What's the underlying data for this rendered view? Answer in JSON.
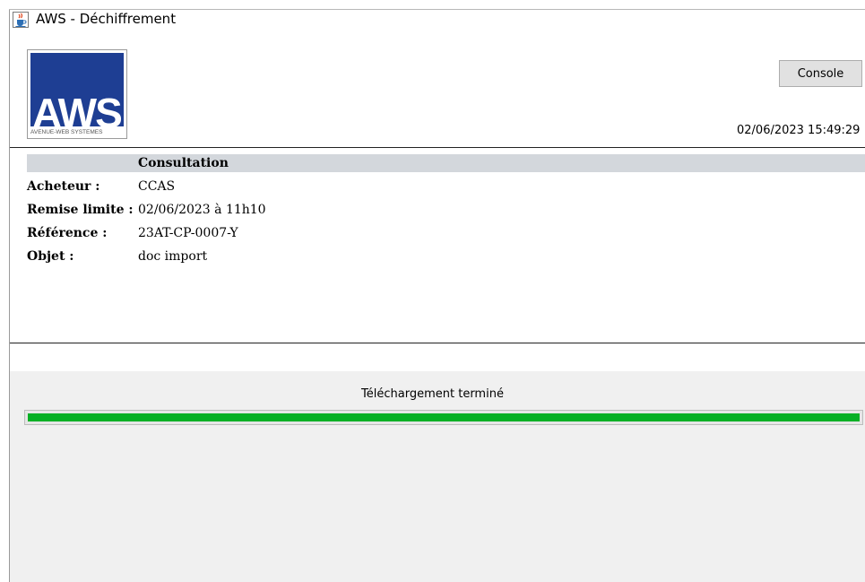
{
  "window": {
    "title": "AWS - Déchiffrement",
    "icon": "java-cup-icon"
  },
  "header": {
    "logo": {
      "text": "AWS",
      "subtitle": "AVENUE-WEB SYSTEMES",
      "color": "#1e3e93"
    },
    "console_label": "Console",
    "datetime": "02/06/2023 15:49:29"
  },
  "consultation": {
    "title": "Consultation",
    "fields": [
      {
        "label": "Acheteur :",
        "value": "CCAS"
      },
      {
        "label": "Remise limite :",
        "value": "02/06/2023 à 11h10"
      },
      {
        "label": "Référence :",
        "value": "23AT-CP-0007-Y"
      },
      {
        "label": "Objet :",
        "value": "doc import"
      }
    ]
  },
  "status": {
    "text": "Téléchargement terminé",
    "progress": 1.0,
    "progress_color": "#06b025"
  }
}
